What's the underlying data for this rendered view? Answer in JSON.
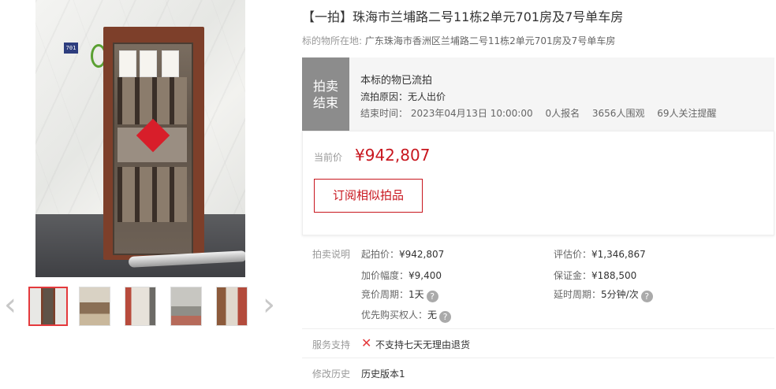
{
  "title": "【一拍】珠海市兰埔路二号11栋2单元701房及7号单车房",
  "location": {
    "label": "标的物所在地:",
    "value": "广东珠海市香洲区兰埔路二号11栋2单元701房及7号单车房"
  },
  "photo": {
    "door_plate": "701"
  },
  "gallery": {
    "thumbnails": [
      "thumb-1",
      "thumb-2",
      "thumb-3",
      "thumb-4",
      "thumb-5"
    ],
    "active_index": 0,
    "prev_icon": "chevron-left-icon",
    "next_icon": "chevron-right-icon"
  },
  "status": {
    "badge_line1": "拍卖",
    "badge_line2": "结束",
    "headline": "本标的物已流拍",
    "reason": "流拍原因：无人出价",
    "end_time": "结束时间：  2023年04月13日 10:00:00",
    "signups": "0人报名",
    "views": "3656人围观",
    "followers": "69人关注提醒"
  },
  "price": {
    "label": "当前价",
    "value": "¥942,807",
    "subscribe_label": "订阅相似拍品"
  },
  "description": {
    "label": "拍卖说明",
    "start_price": {
      "k": "起拍价：",
      "v": "¥942,807"
    },
    "increment": {
      "k": "加价幅度：",
      "v": "¥9,400"
    },
    "period": {
      "k": "竞价周期：",
      "v": "1天"
    },
    "priority": {
      "k": "优先购买权人：",
      "v": "无"
    },
    "appraisal": {
      "k": "评估价：",
      "v": "¥1,346,867"
    },
    "deposit": {
      "k": "保证金：",
      "v": "¥188,500"
    },
    "delay": {
      "k": "延时周期：",
      "v": "5分钟/次"
    }
  },
  "service": {
    "label": "服务支持",
    "text": "不支持七天无理由退货"
  },
  "history": {
    "label": "修改历史",
    "value": "历史版本1"
  },
  "colors": {
    "accent_red": "#c8161e",
    "badge_gray": "#8c8c8c"
  }
}
